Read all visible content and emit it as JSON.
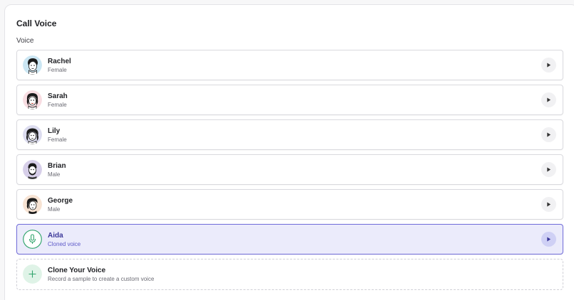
{
  "section": {
    "title": "Call Voice",
    "field_label": "Voice"
  },
  "voices": [
    {
      "name": "Rachel",
      "description": "Female",
      "avatar": "rachel-avatar-icon",
      "avatar_bg": "#cbe6f3"
    },
    {
      "name": "Sarah",
      "description": "Female",
      "avatar": "sarah-avatar-icon",
      "avatar_bg": "#f8dde2"
    },
    {
      "name": "Lily",
      "description": "Female",
      "avatar": "lily-avatar-icon",
      "avatar_bg": "#dcdcef"
    },
    {
      "name": "Brian",
      "description": "Male",
      "avatar": "brian-avatar-icon",
      "avatar_bg": "#d7cfe9"
    },
    {
      "name": "George",
      "description": "Male",
      "avatar": "george-avatar-icon",
      "avatar_bg": "#f7e3d3"
    },
    {
      "name": "Aida",
      "description": "Cloned voice",
      "avatar": "microphone-icon",
      "selected": true
    }
  ],
  "clone": {
    "title": "Clone Your Voice",
    "description": "Record a sample to create a custom voice",
    "icon": "plus-icon"
  },
  "colors": {
    "accent": "#6f6ad8",
    "selected_bg": "#ebebfb",
    "green": "#2fa36b",
    "green_bg": "#dff3e7"
  }
}
